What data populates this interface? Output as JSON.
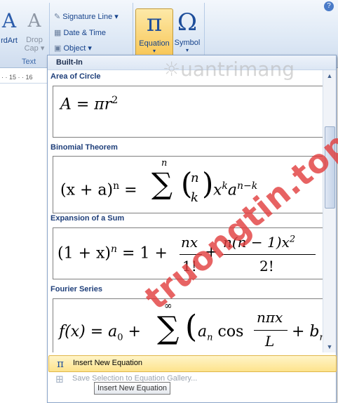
{
  "ribbon": {
    "wordart_label": "rdArt",
    "dropcap_label1": "Drop",
    "dropcap_label2": "Cap",
    "signature_line": "Signature Line",
    "date_time": "Date & Time",
    "object": "Object",
    "text_group": "Text",
    "equation_label": "Equation",
    "symbol_label": "Symbol",
    "pi_glyph": "π",
    "omega_glyph": "Ω"
  },
  "ruler": {
    "marks": "· · 15 · · 16"
  },
  "panel": {
    "header": "Built-In",
    "sections": [
      {
        "title": "Area of Circle"
      },
      {
        "title": "Binomial Theorem"
      },
      {
        "title": "Expansion of a Sum"
      },
      {
        "title": "Fourier Series"
      }
    ]
  },
  "math": {
    "area": "A = πr",
    "area_exp": "2",
    "binom_lhs": "(x + a)",
    "binom_n": "n",
    "binom_eq": "=",
    "binom_sum": "∑",
    "binom_top": "n",
    "binom_k": "k",
    "binom_paren_l": "(",
    "binom_paren_r": ")",
    "binom_rhs": "x",
    "binom_xk": "k",
    "binom_a": "a",
    "binom_nk": "n−k",
    "exp_lhs": "(1 + x)",
    "exp_n": "n",
    "exp_mid": "= 1 +",
    "exp_f1_num": "nx",
    "exp_f1_den": "1!",
    "exp_plus": "+",
    "exp_f2_num": "n(n − 1)x",
    "exp_f2_exp": "2",
    "exp_f2_den": "2!",
    "fou_lhs": "f(x) = a",
    "fou_sub0": "0",
    "fou_plus": "+",
    "fou_sum": "∑",
    "fou_inf": "∞",
    "fou_paren": "(",
    "fou_an": "a",
    "fou_n": "n",
    "fou_cos": "cos",
    "fou_num": "nπx",
    "fou_den": "L",
    "fou_plus2": "+ b",
    "fou_bn": "n"
  },
  "menu": {
    "insert_new": "Insert New Equation",
    "save_selection": "Save Selection to Equation Gallery..."
  },
  "tooltip": "Insert New Equation",
  "watermarks": {
    "top": "uantrimang",
    "diagonal": "truongtin.top"
  }
}
